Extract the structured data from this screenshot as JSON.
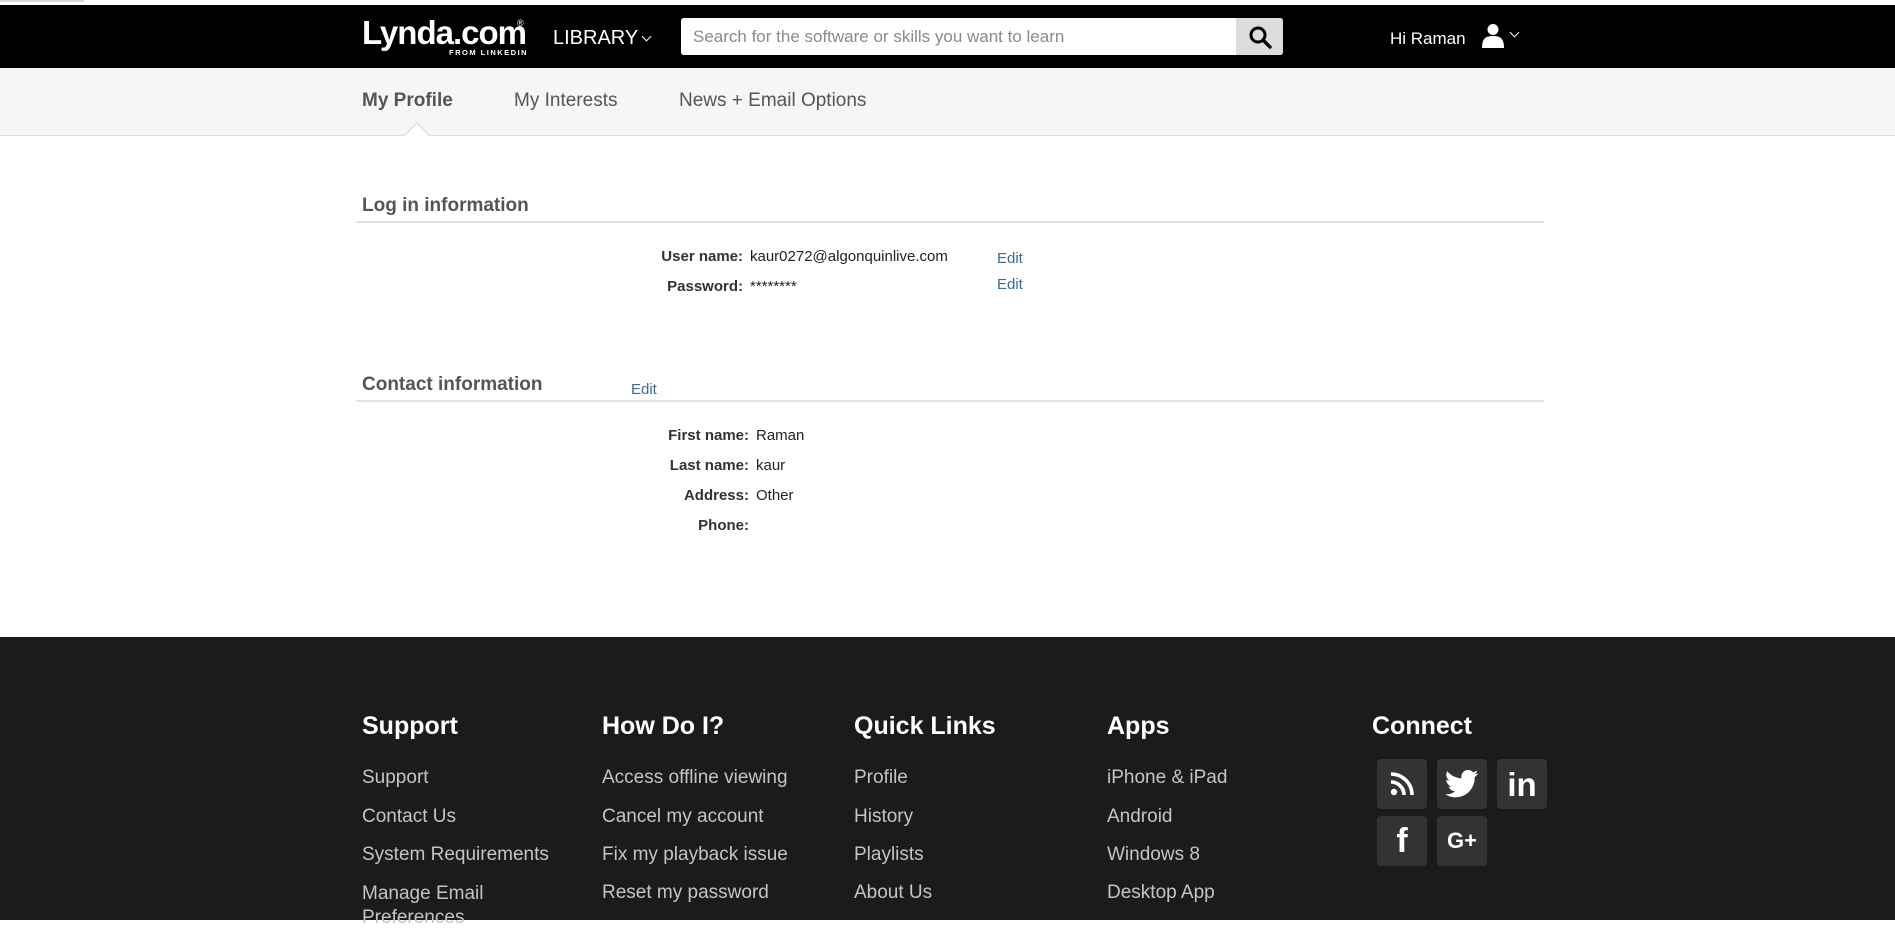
{
  "header": {
    "logo": {
      "brand": "Lynda.com",
      "mark": "®",
      "subtitle": "FROM LINKEDIN"
    },
    "library_label": "LIBRARY",
    "search": {
      "placeholder": "Search for the software or skills you want to learn",
      "value": "",
      "button_icon": "search-icon"
    },
    "greeting": "Hi Raman",
    "user_icon": "user-icon"
  },
  "tabs": [
    {
      "label": "My Profile",
      "active": true
    },
    {
      "label": "My Interests",
      "active": false
    },
    {
      "label": "News + Email Options",
      "active": false
    }
  ],
  "login_section": {
    "title": "Log in information",
    "fields": [
      {
        "label": "User name:",
        "value": "kaur0272@algonquinlive.com",
        "action": "Edit"
      },
      {
        "label": "Password:",
        "value": "********",
        "action": "Edit"
      }
    ]
  },
  "contact_section": {
    "title": "Contact information",
    "action": "Edit",
    "fields": [
      {
        "label": "First name:",
        "value": "Raman"
      },
      {
        "label": "Last name:",
        "value": "kaur"
      },
      {
        "label": "Address:",
        "value": "Other"
      },
      {
        "label": "Phone:",
        "value": ""
      }
    ]
  },
  "footer": {
    "columns": [
      {
        "title": "Support",
        "links": [
          "Support",
          "Contact Us",
          "System Requirements",
          "Manage Email Preferences"
        ]
      },
      {
        "title": "How Do I?",
        "links": [
          "Access offline viewing",
          "Cancel my account",
          "Fix my playback issue",
          "Reset my password"
        ]
      },
      {
        "title": "Quick Links",
        "links": [
          "Profile",
          "History",
          "Playlists",
          "About Us"
        ]
      },
      {
        "title": "Apps",
        "links": [
          "iPhone & iPad",
          "Android",
          "Windows 8",
          "Desktop App"
        ]
      }
    ],
    "connect": {
      "title": "Connect",
      "icons": [
        "rss-icon",
        "twitter-icon",
        "linkedin-icon",
        "facebook-icon",
        "google-plus-icon"
      ],
      "linkedin_glyph": "in",
      "facebook_glyph": "f",
      "google_plus_glyph": "G+"
    }
  },
  "colors": {
    "header_bg": "#000000",
    "subnav_bg": "#f6f6f6",
    "footer_bg": "#1b1b1b",
    "link": "#3b6b8f",
    "social_bg": "#333333"
  }
}
